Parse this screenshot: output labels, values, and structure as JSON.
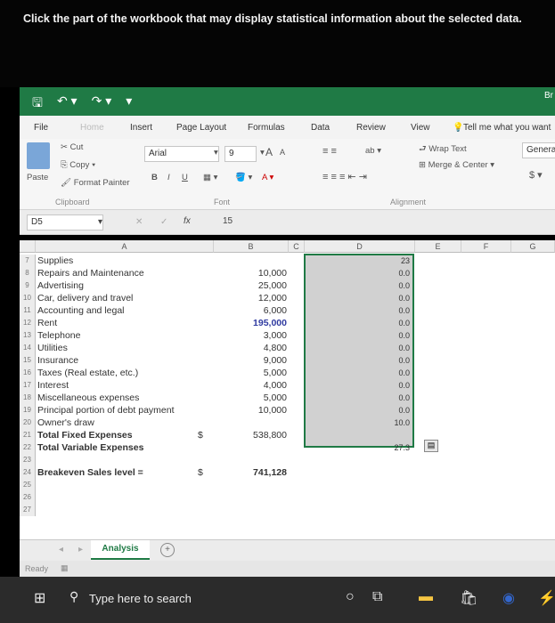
{
  "question": "Click the part of the workbook that may display statistical information about the selected data.",
  "titlebar": {
    "right_text": "Br"
  },
  "tabs": [
    "File",
    "Home",
    "Insert",
    "Page Layout",
    "Formulas",
    "Data",
    "Review",
    "View"
  ],
  "tell_me": "Tell me what you want",
  "ribbon": {
    "paste": "Paste",
    "cut": "Cut",
    "copy": "Copy",
    "format_painter": "Format Painter",
    "clipboard": "Clipboard",
    "font_name": "Arial",
    "font_size": "9",
    "font_label": "Font",
    "bold": "B",
    "italic": "I",
    "underline": "U",
    "wrap_text": "Wrap Text",
    "merge_center": "Merge & Center",
    "alignment": "Alignment",
    "number_format": "Genera",
    "currency": "$"
  },
  "formula_bar": {
    "name_box": "D5",
    "fx": "fx",
    "value": "15"
  },
  "columns": [
    "A",
    "B",
    "C",
    "D",
    "E",
    "F",
    "G"
  ],
  "rows": [
    {
      "num": "7",
      "a": "Supplies",
      "b": "",
      "d": "23"
    },
    {
      "num": "8",
      "a": "Repairs and Maintenance",
      "b": "10,000",
      "d": "0.0"
    },
    {
      "num": "9",
      "a": "Advertising",
      "b": "25,000",
      "d": "0.0"
    },
    {
      "num": "10",
      "a": "Car, delivery and travel",
      "b": "12,000",
      "d": "0.0"
    },
    {
      "num": "11",
      "a": "Accounting and legal",
      "b": "6,000",
      "d": "0.0"
    },
    {
      "num": "12",
      "a": "Rent",
      "b": "195,000",
      "d": "0.0"
    },
    {
      "num": "13",
      "a": "Telephone",
      "b": "3,000",
      "d": "0.0"
    },
    {
      "num": "14",
      "a": "Utilities",
      "b": "4,800",
      "d": "0.0"
    },
    {
      "num": "15",
      "a": "Insurance",
      "b": "9,000",
      "d": "0.0"
    },
    {
      "num": "16",
      "a": "Taxes (Real estate, etc.)",
      "b": "5,000",
      "d": "0.0"
    },
    {
      "num": "17",
      "a": "Interest",
      "b": "4,000",
      "d": "0.0"
    },
    {
      "num": "18",
      "a": "Miscellaneous expenses",
      "b": "5,000",
      "d": "0.0"
    },
    {
      "num": "19",
      "a": "Principal portion of debt payment",
      "b": "10,000",
      "d": "0.0"
    },
    {
      "num": "20",
      "a": "Owner's draw",
      "b": "",
      "d": "10.0"
    },
    {
      "num": "21",
      "a": "Total Fixed Expenses",
      "b": "538,800",
      "d": "",
      "currency": "$"
    },
    {
      "num": "22",
      "a": "Total Variable Expenses",
      "b": "",
      "d": "27.3"
    },
    {
      "num": "23",
      "a": "",
      "b": "",
      "d": ""
    },
    {
      "num": "24",
      "a": "Breakeven Sales level =",
      "b": "741,128",
      "d": "",
      "currency": "$"
    },
    {
      "num": "25",
      "a": "",
      "b": "",
      "d": ""
    },
    {
      "num": "26",
      "a": "",
      "b": "",
      "d": ""
    },
    {
      "num": "27",
      "a": "",
      "b": "",
      "d": ""
    }
  ],
  "sheet_tab": "Analysis",
  "status": "Ready",
  "taskbar": {
    "search": "Type here to search"
  }
}
